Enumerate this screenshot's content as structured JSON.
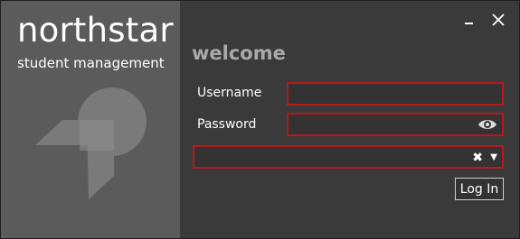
{
  "app": {
    "title": "northstar",
    "subtitle": "student management"
  },
  "window_controls": {
    "minimize_icon": "minimize-icon",
    "close_icon": "close-icon"
  },
  "form": {
    "heading": "welcome",
    "username_label": "Username",
    "username_value": "",
    "password_label": "Password",
    "password_value": "",
    "selection_value": "",
    "login_label": "Log In"
  },
  "colors": {
    "left_pane": "#5b5b5b",
    "background": "#3a3a3a",
    "field_border_error": "#b51a1a",
    "heading": "#a9a9a9"
  }
}
